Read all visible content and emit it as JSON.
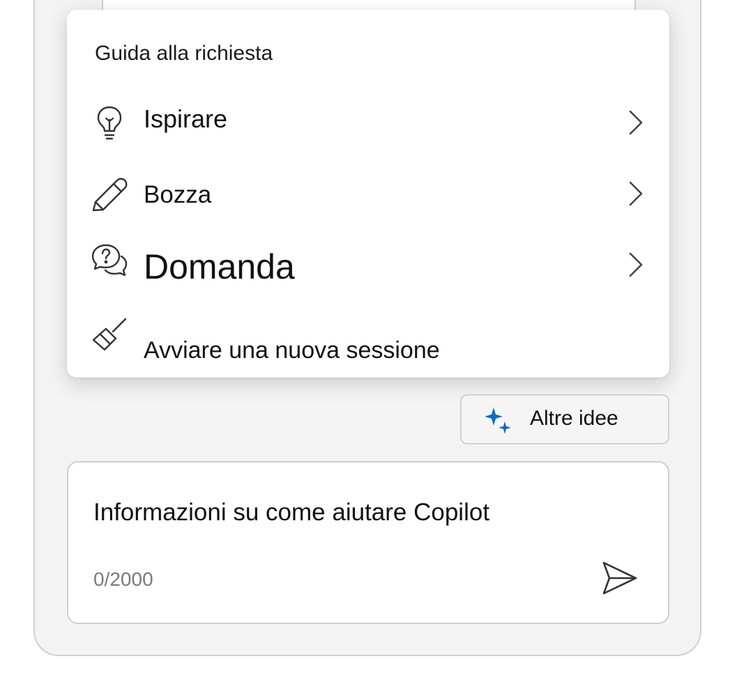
{
  "menu": {
    "header": "Guida alla richiesta",
    "items": [
      {
        "label": "Ispirare",
        "icon": "lightbulb-icon",
        "has_submenu": true
      },
      {
        "label": "Bozza",
        "icon": "pencil-icon",
        "has_submenu": true
      },
      {
        "label": "Domanda",
        "icon": "chat-question-icon",
        "has_submenu": true
      },
      {
        "label": "Avviare una nuova sessione",
        "icon": "broom-icon",
        "has_submenu": false
      }
    ]
  },
  "more_ideas": {
    "label": "Altre idee",
    "icon": "sparkle-icon",
    "accent": "#0f6cbd"
  },
  "compose": {
    "value": "Informazioni su come aiutare Copilot",
    "counter": "0/2000",
    "send_icon": "send-icon"
  }
}
